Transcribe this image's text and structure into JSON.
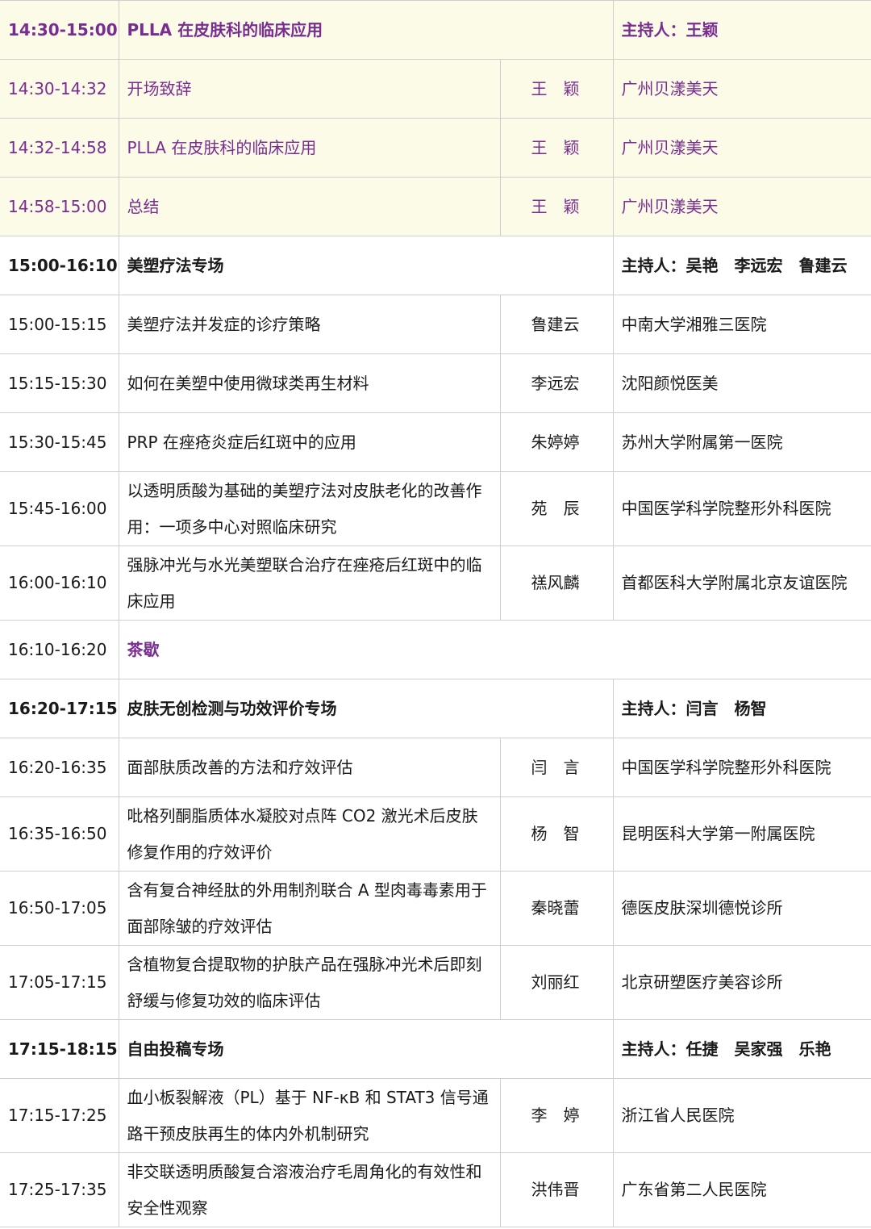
{
  "schedule": {
    "session1": {
      "time": "14:30-15:00",
      "title": "PLLA 在皮肤科的临床应用",
      "host": "主持人：王颖",
      "talks": [
        {
          "time": "14:30-14:32",
          "title": "开场致辞",
          "speaker": "王　颖",
          "affiliation": "广州贝漾美天"
        },
        {
          "time": "14:32-14:58",
          "title": "PLLA 在皮肤科的临床应用",
          "speaker": "王　颖",
          "affiliation": "广州贝漾美天"
        },
        {
          "time": "14:58-15:00",
          "title": "总结",
          "speaker": "王　颖",
          "affiliation": "广州贝漾美天"
        }
      ]
    },
    "session2": {
      "time": "15:00-16:10",
      "title": "美塑疗法专场",
      "host": "主持人：吴艳　李远宏　鲁建云",
      "talks": [
        {
          "time": "15:00-15:15",
          "title": "美塑疗法并发症的诊疗策略",
          "speaker": "鲁建云",
          "affiliation": "中南大学湘雅三医院"
        },
        {
          "time": "15:15-15:30",
          "title": "如何在美塑中使用微球类再生材料",
          "speaker": "李远宏",
          "affiliation": "沈阳颜悦医美"
        },
        {
          "time": "15:30-15:45",
          "title": "PRP 在痤疮炎症后红斑中的应用",
          "speaker": "朱婷婷",
          "affiliation": "苏州大学附属第一医院"
        },
        {
          "time": "15:45-16:00",
          "title": "以透明质酸为基础的美塑疗法对皮肤老化的改善作用：一项多中心对照临床研究",
          "speaker": "苑　辰",
          "affiliation": "中国医学科学院整形外科医院"
        },
        {
          "time": "16:00-16:10",
          "title": "强脉冲光与水光美塑联合治疗在痤疮后红斑中的临床应用",
          "speaker": "禚风麟",
          "affiliation": "首都医科大学附属北京友谊医院"
        }
      ]
    },
    "break": {
      "time": "16:10-16:20",
      "title": "茶歇"
    },
    "session3": {
      "time": "16:20-17:15",
      "title": "皮肤无创检测与功效评价专场",
      "host": "主持人：闫言　杨智",
      "talks": [
        {
          "time": "16:20-16:35",
          "title": "面部肤质改善的方法和疗效评估",
          "speaker": "闫　言",
          "affiliation": "中国医学科学院整形外科医院"
        },
        {
          "time": "16:35-16:50",
          "title": "吡格列酮脂质体水凝胶对点阵 CO2 激光术后皮肤修复作用的疗效评价",
          "speaker": "杨　智",
          "affiliation": "昆明医科大学第一附属医院"
        },
        {
          "time": "16:50-17:05",
          "title": "含有复合神经肽的外用制剂联合 A 型肉毒毒素用于面部除皱的疗效评估",
          "speaker": "秦晓蕾",
          "affiliation": "德医皮肤深圳德悦诊所"
        },
        {
          "time": "17:05-17:15",
          "title": "含植物复合提取物的护肤产品在强脉冲光术后即刻舒缓与修复功效的临床评估",
          "speaker": "刘丽红",
          "affiliation": "北京研塑医疗美容诊所"
        }
      ]
    },
    "session4": {
      "time": "17:15-18:15",
      "title": "自由投稿专场",
      "host": "主持人：任捷　吴家强　乐艳",
      "talks": [
        {
          "time": "17:15-17:25",
          "title": "血小板裂解液（PL）基于 NF-κB 和 STAT3 信号通路干预皮肤再生的体内外机制研究",
          "speaker": "李　婷",
          "affiliation": "浙江省人民医院"
        },
        {
          "time": "17:25-17:35",
          "title": "非交联透明质酸复合溶液治疗毛周角化的有效性和安全性观察",
          "speaker": "洪伟晋",
          "affiliation": "广东省第二人民医院"
        }
      ]
    }
  }
}
